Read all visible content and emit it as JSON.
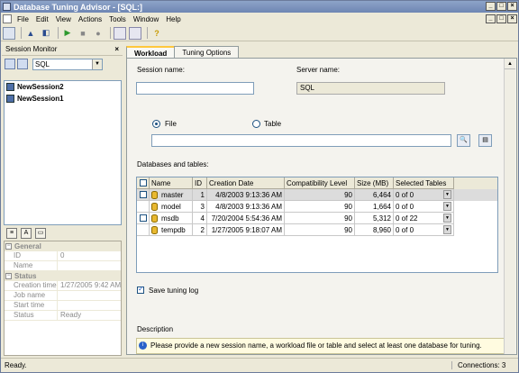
{
  "title_bar": {
    "title": "Database Tuning Advisor - [SQL:]"
  },
  "menu": {
    "items": [
      "File",
      "Edit",
      "View",
      "Actions",
      "Tools",
      "Window",
      "Help"
    ]
  },
  "session_monitor": {
    "title": "Session Monitor",
    "server_combo": "SQL",
    "sessions": [
      "NewSession2",
      "NewSession1"
    ]
  },
  "properties": {
    "general_label": "General",
    "id_label": "ID",
    "id_value": "0",
    "name_label": "Name",
    "name_value": "",
    "status_label": "Status",
    "creation_label": "Creation time",
    "creation_value": "1/27/2005 9:42 AM",
    "jobname_label": "Job name",
    "jobname_value": "",
    "start_label": "Start time",
    "start_value": "",
    "statusrow_label": "Status",
    "statusrow_value": "Ready"
  },
  "tabs": [
    {
      "label": "Workload"
    },
    {
      "label": "Tuning Options"
    }
  ],
  "workload": {
    "session_name_label": "Session name:",
    "session_name_value": "",
    "server_name_label": "Server name:",
    "server_name_value": "SQL",
    "file_label": "File",
    "table_label": "Table",
    "file_value": "",
    "dbtables_label": "Databases and tables:",
    "save_log_label": "Save tuning log",
    "description_label": "Description",
    "description_text": "Please provide a new session name, a workload file or table and select at least one database for tuning."
  },
  "grid": {
    "columns": [
      "Name",
      "ID",
      "Creation Date",
      "Compatibility Level",
      "Size (MB)",
      "Selected Tables"
    ],
    "rows": [
      {
        "name": "master",
        "id": "1",
        "date": "4/8/2003 9:13:36 AM",
        "compat": "90",
        "size": "6,464",
        "tables": "0 of 0",
        "checked": false
      },
      {
        "name": "model",
        "id": "3",
        "date": "4/8/2003 9:13:36 AM",
        "compat": "90",
        "size": "1,664",
        "tables": "0 of 0",
        "checked": false
      },
      {
        "name": "msdb",
        "id": "4",
        "date": "7/20/2004 5:54:36 AM",
        "compat": "90",
        "size": "5,312",
        "tables": "0 of 22",
        "checked": false
      },
      {
        "name": "tempdb",
        "id": "2",
        "date": "1/27/2005 9:18:07 AM",
        "compat": "90",
        "size": "8,960",
        "tables": "0 of 0",
        "checked": false
      }
    ]
  },
  "statusbar": {
    "left": "Ready.",
    "right": "Connections: 3"
  }
}
